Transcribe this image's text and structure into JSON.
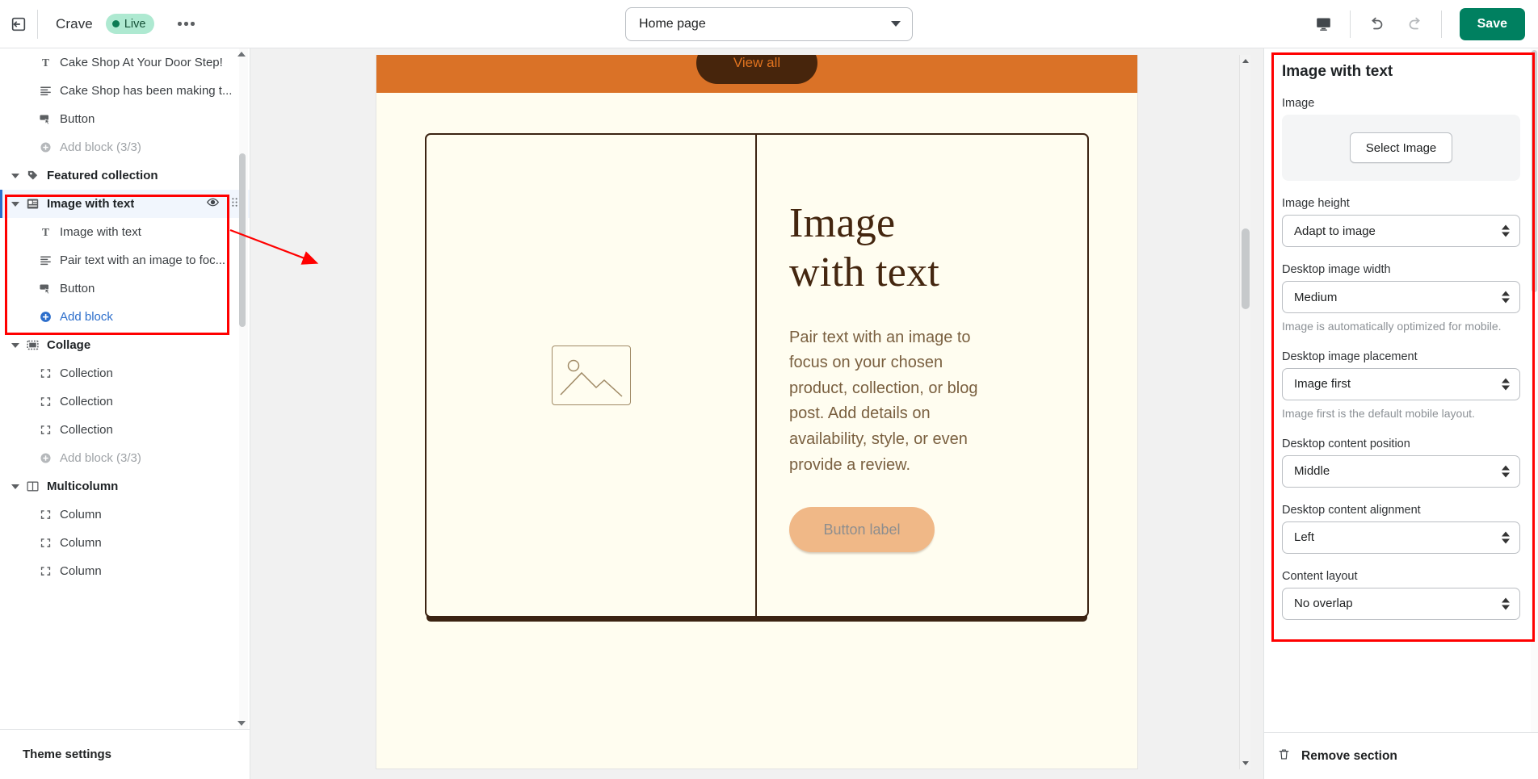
{
  "topbar": {
    "exit_icon": "exit-to-app-icon",
    "shop_name": "Crave",
    "status_badge": "Live",
    "more_menu": "more-options-icon",
    "page_selector_value": "Home page",
    "device_icon": "desktop-preview-icon",
    "undo_icon": "undo-icon",
    "redo_icon": "redo-icon",
    "save_label": "Save"
  },
  "sidebar": {
    "items": [
      {
        "label": "Cake Shop At Your Door Step!",
        "icon": "text-block-icon",
        "level": "block",
        "state": "normal"
      },
      {
        "label": "Cake Shop has been making t...",
        "icon": "paragraph-icon",
        "level": "block",
        "state": "normal"
      },
      {
        "label": "Button",
        "icon": "button-icon",
        "level": "block",
        "state": "normal"
      },
      {
        "label": "Add block (3/3)",
        "icon": "add-circle-icon",
        "level": "block",
        "state": "disabled"
      },
      {
        "label": "Featured collection",
        "icon": "tag-icon",
        "level": "section",
        "state": "normal",
        "collapsed": true
      },
      {
        "label": "Image with text",
        "icon": "image-with-text-icon",
        "level": "section",
        "state": "selected",
        "eye": "eye-icon",
        "drag": "drag-handle-icon"
      },
      {
        "label": "Image with text",
        "icon": "text-block-icon",
        "level": "block",
        "state": "normal"
      },
      {
        "label": "Pair text with an image to foc...",
        "icon": "paragraph-icon",
        "level": "block",
        "state": "normal"
      },
      {
        "label": "Button",
        "icon": "button-icon",
        "level": "block",
        "state": "normal"
      },
      {
        "label": "Add block",
        "icon": "add-circle-filled-icon",
        "level": "block",
        "state": "link"
      },
      {
        "label": "Collage",
        "icon": "collage-icon",
        "level": "section",
        "state": "normal"
      },
      {
        "label": "Collection",
        "icon": "frame-icon",
        "level": "block",
        "state": "normal"
      },
      {
        "label": "Collection",
        "icon": "frame-icon",
        "level": "block",
        "state": "normal"
      },
      {
        "label": "Collection",
        "icon": "frame-icon",
        "level": "block",
        "state": "normal"
      },
      {
        "label": "Add block (3/3)",
        "icon": "add-circle-icon",
        "level": "block",
        "state": "disabled"
      },
      {
        "label": "Multicolumn",
        "icon": "multicolumn-icon",
        "level": "section",
        "state": "normal"
      },
      {
        "label": "Column",
        "icon": "frame-icon",
        "level": "block",
        "state": "normal"
      },
      {
        "label": "Column",
        "icon": "frame-icon",
        "level": "block",
        "state": "normal"
      },
      {
        "label": "Column",
        "icon": "frame-icon",
        "level": "block",
        "state": "normal"
      }
    ],
    "footer_label": "Theme settings"
  },
  "preview": {
    "view_all_label": "View all",
    "heading_line1": "Image",
    "heading_line2": "with text",
    "paragraph": "Pair text with an image to focus on your chosen product, collection, or blog post. Add details on availability, style, or even provide a review.",
    "button_label": "Button label",
    "image_placeholder_icon": "image-placeholder-icon"
  },
  "settings": {
    "title": "Image with text",
    "image_label": "Image",
    "select_image_label": "Select Image",
    "fields": [
      {
        "label": "Image height",
        "value": "Adapt to image",
        "helper": ""
      },
      {
        "label": "Desktop image width",
        "value": "Medium",
        "helper": "Image is automatically optimized for mobile."
      },
      {
        "label": "Desktop image placement",
        "value": "Image first",
        "helper": "Image first is the default mobile layout."
      },
      {
        "label": "Desktop content position",
        "value": "Middle",
        "helper": ""
      },
      {
        "label": "Desktop content alignment",
        "value": "Left",
        "helper": ""
      },
      {
        "label": "Content layout",
        "value": "No overlap",
        "helper": ""
      }
    ],
    "remove_label": "Remove section",
    "remove_icon": "trash-icon"
  },
  "colors": {
    "accent_green": "#008060",
    "live_badge_bg": "#aee9d1",
    "selected_blue": "#2c6ecb",
    "annotation_red": "#ff0000",
    "preview_orange": "#da7227",
    "preview_brown": "#3b2312",
    "preview_cream": "#fffdf0",
    "button_peach": "#f0b887"
  }
}
